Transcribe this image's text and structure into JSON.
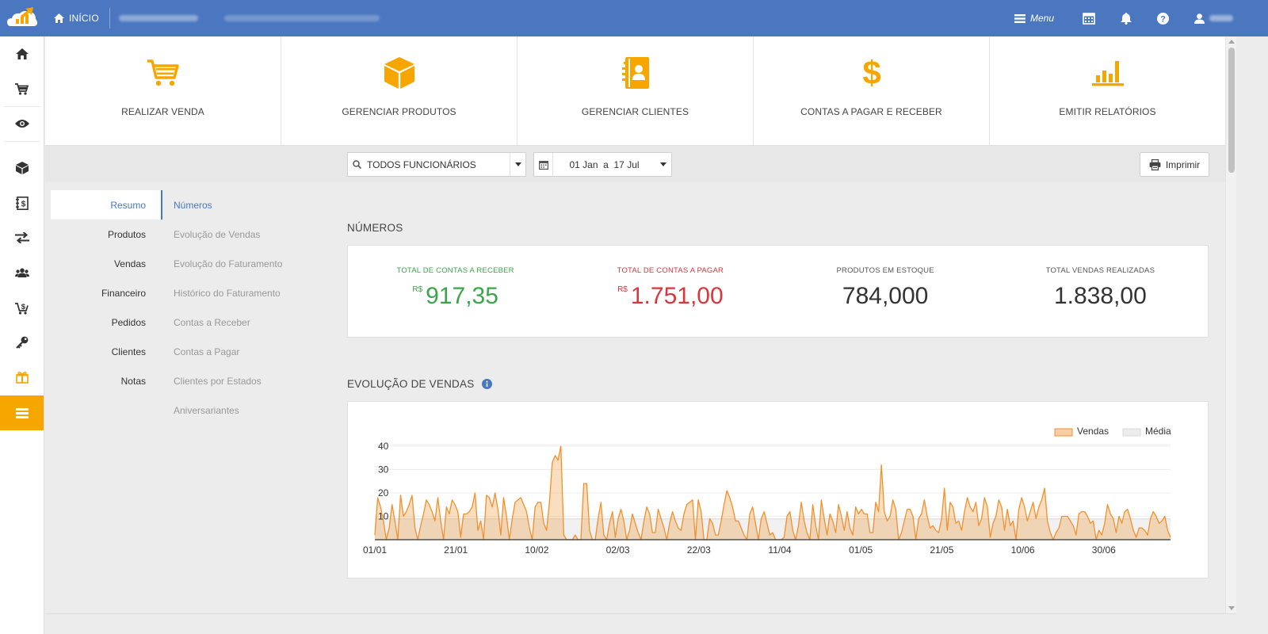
{
  "topbar": {
    "home_label": "INÍCIO",
    "menu_label": "Menu",
    "icons": [
      "calendar-icon",
      "bell-icon",
      "help-icon",
      "user-icon"
    ],
    "color": "#4a77c0"
  },
  "sidebar": {
    "icons": [
      "home-icon",
      "cart-icon",
      "eye-icon",
      "box-icon",
      "ledger-icon",
      "transfer-icon",
      "users-icon",
      "cart-dollar-icon",
      "key-icon",
      "gift-icon",
      "menu-icon"
    ],
    "active_color": "#f7a600"
  },
  "actions": [
    {
      "label": "REALIZAR VENDA",
      "icon": "cart-icon"
    },
    {
      "label": "GERENCIAR PRODUTOS",
      "icon": "box-icon"
    },
    {
      "label": "GERENCIAR CLIENTES",
      "icon": "address-book-icon"
    },
    {
      "label": "CONTAS A PAGAR E RECEBER",
      "icon": "dollar-icon"
    },
    {
      "label": "EMITIR RELATÓRIOS",
      "icon": "bar-chart-icon"
    }
  ],
  "filters": {
    "employee": "TODOS FUNCIONÁRIOS",
    "date_range": "01 Jan  a  17 Jul",
    "print_label": "Imprimir"
  },
  "nav": {
    "categories": [
      "Resumo",
      "Produtos",
      "Vendas",
      "Financeiro",
      "Pedidos",
      "Clientes",
      "Notas"
    ],
    "active_category": "Resumo",
    "subitems": [
      "Números",
      "Evolução de Vendas",
      "Evolução do Faturamento",
      "Histórico do Faturamento",
      "Contas a Receber",
      "Contas a Pagar",
      "Clientes por Estados",
      "Aniversariantes"
    ],
    "active_subitem": "Números"
  },
  "numeros": {
    "title": "NÚMEROS",
    "currency": "R$",
    "kpis": [
      {
        "label": "TOTAL DE CONTAS A RECEBER",
        "value": "917,35",
        "currency": "R$",
        "color": "#3aa64a"
      },
      {
        "label": "TOTAL DE CONTAS A PAGAR",
        "value": "1.751,00",
        "currency": "R$",
        "color": "#d9363e"
      },
      {
        "label": "PRODUTOS EM ESTOQUE",
        "value": "784,000",
        "currency": "",
        "color": "#333333"
      },
      {
        "label": "TOTAL VENDAS REALIZADAS",
        "value": "1.838,00",
        "currency": "",
        "color": "#333333"
      }
    ]
  },
  "evolucao": {
    "title": "EVOLUÇÃO DE VENDAS",
    "info_icon": "info-icon"
  },
  "chart_data": {
    "type": "area",
    "x_ticks": [
      "01/01",
      "21/01",
      "10/02",
      "02/03",
      "22/03",
      "11/04",
      "01/05",
      "21/05",
      "10/06",
      "30/06"
    ],
    "y_ticks": [
      10,
      20,
      30,
      40
    ],
    "ylim": [
      0,
      42
    ],
    "xlabel": "",
    "ylabel": "",
    "grid": true,
    "legend_position": "top-right",
    "series": [
      {
        "name": "Vendas",
        "color": "#f0912e",
        "values": [
          2,
          18,
          14,
          8,
          0,
          5,
          15,
          8,
          0,
          19,
          10,
          12,
          15,
          19,
          5,
          0,
          6,
          11,
          17,
          15,
          12,
          8,
          18,
          8,
          0,
          14,
          11,
          17,
          15,
          12,
          1,
          11,
          11,
          12,
          14,
          20,
          4,
          8,
          0,
          19,
          18,
          14,
          20,
          13,
          2,
          18,
          10,
          0,
          9,
          16,
          17,
          18,
          15,
          12,
          5,
          0,
          14,
          16,
          16,
          7,
          4,
          16,
          33,
          36,
          34,
          40,
          2,
          0,
          0,
          0,
          2,
          0,
          0,
          24,
          24,
          4,
          0,
          0,
          9,
          16,
          2,
          0,
          7,
          12,
          1,
          9,
          13,
          8,
          0,
          4,
          11,
          7,
          3,
          0,
          8,
          14,
          11,
          3,
          3,
          13,
          9,
          5,
          0,
          7,
          12,
          8,
          5,
          4,
          11,
          15,
          16,
          17,
          0,
          17,
          12,
          0,
          0,
          9,
          7,
          2,
          2,
          8,
          15,
          21,
          18,
          14,
          8,
          8,
          5,
          2,
          0,
          11,
          14,
          7,
          0,
          9,
          12,
          7,
          2,
          3,
          0,
          0,
          0,
          1,
          10,
          12,
          4,
          0,
          6,
          16,
          8,
          3,
          0,
          15,
          6,
          0,
          17,
          9,
          2,
          11,
          8,
          3,
          15,
          10,
          4,
          12,
          5,
          2,
          14,
          11,
          13,
          11,
          11,
          3,
          3,
          16,
          12,
          32,
          12,
          8,
          10,
          17,
          13,
          0,
          3,
          8,
          13,
          13,
          10,
          0,
          9,
          11,
          17,
          10,
          5,
          6,
          4,
          3,
          9,
          22,
          4,
          16,
          14,
          7,
          8,
          4,
          12,
          18,
          14,
          12,
          16,
          6,
          9,
          18,
          14,
          1,
          7,
          10,
          17,
          14,
          4,
          13,
          6,
          8,
          0,
          13,
          18,
          14,
          8,
          12,
          16,
          9,
          14,
          17,
          22,
          8,
          3,
          0,
          3,
          5,
          10,
          10,
          10,
          8,
          6,
          2,
          11,
          12,
          12,
          10,
          7,
          8,
          0,
          4,
          2,
          7,
          15,
          11,
          9,
          3,
          10,
          7,
          12,
          13,
          9,
          4,
          1,
          5,
          5,
          4,
          2,
          9,
          12,
          10,
          7,
          8,
          10,
          4,
          1
        ]
      },
      {
        "name": "Média",
        "color": "#e0e0e0",
        "average": 8.9
      }
    ]
  }
}
